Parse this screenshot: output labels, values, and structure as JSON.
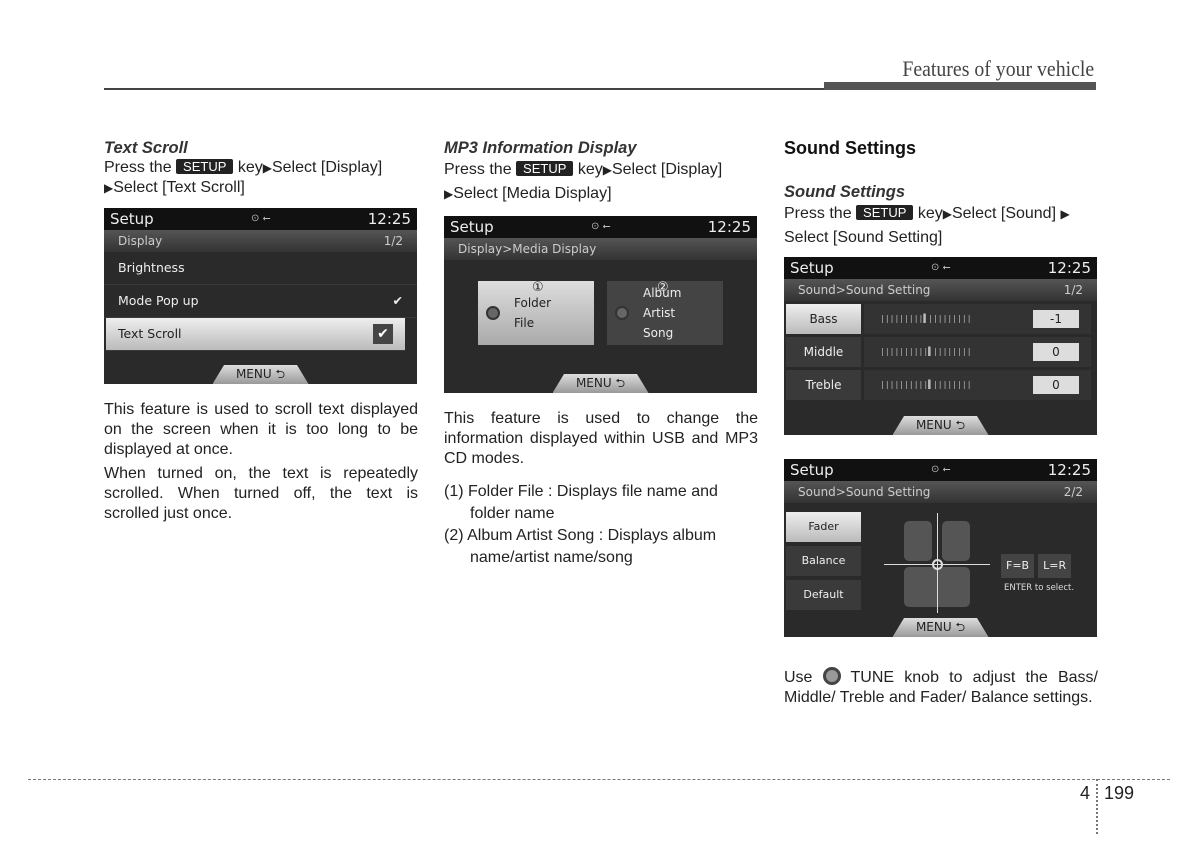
{
  "header": {
    "section_title": "Features of your vehicle"
  },
  "footer": {
    "chapter": "4",
    "page": "199"
  },
  "col1": {
    "subtitle": "Text Scroll",
    "instr_pre": "Press the ",
    "key": "SETUP",
    "instr_mid": " key",
    "arrow": "▶",
    "instr_a": "Select [Display]",
    "instr_b": "Select [Text Scroll]",
    "screen": {
      "title": "Setup",
      "icons": "⊙ ⭠",
      "time": "12:25",
      "breadcrumb": "Display",
      "page": "1/2",
      "items": [
        {
          "label": "Brightness",
          "check": ""
        },
        {
          "label": "Mode Pop up",
          "check": "✔"
        },
        {
          "label": "Text Scroll",
          "check": "✔"
        }
      ],
      "menu": "MENU ⮌"
    },
    "para1": "This feature is used to scroll text displayed on the screen when it is too long to be displayed at once.",
    "para2": "When turned on, the text is repeatedly scrolled. When turned off, the text is scrolled just once."
  },
  "col2": {
    "subtitle": "MP3 Information Display",
    "instr_pre": "Press the ",
    "key": "SETUP",
    "instr_mid": " key",
    "arrow": "▶",
    "instr_a": "Select [Display]",
    "instr_b": "Select [Media Display]",
    "screen": {
      "title": "Setup",
      "icons": "⊙ ⭠",
      "time": "12:25",
      "breadcrumb": "Display>Media Display",
      "options": [
        {
          "num": "①",
          "label": "Folder File"
        },
        {
          "num": "②",
          "label": "Album Artist Song"
        }
      ],
      "menu": "MENU ⮌"
    },
    "para1": "This feature is used to change the information displayed within USB and MP3 CD modes.",
    "list": [
      "(1) Folder File : Displays file name and folder name",
      "(2) Album Artist Song : Displays album name/artist name/song"
    ]
  },
  "col3": {
    "heading": "Sound Settings",
    "subtitle": "Sound Settings",
    "instr_pre": "Press the ",
    "key": "SETUP",
    "instr_mid": " key",
    "arrow": "▶",
    "instr_a": "Select [Sound]",
    "instr_b": "Select [Sound Setting]",
    "screen1": {
      "title": "Setup",
      "icons": "⊙ ⭠",
      "time": "12:25",
      "breadcrumb": "Sound>Sound Setting",
      "page": "1/2",
      "rows": [
        {
          "label": "Bass",
          "value": "-1",
          "level": -1
        },
        {
          "label": "Middle",
          "value": "0",
          "level": 0
        },
        {
          "label": "Treble",
          "value": "0",
          "level": 0
        }
      ],
      "menu": "MENU ⮌"
    },
    "screen2": {
      "title": "Setup",
      "icons": "⊙ ⭠",
      "time": "12:25",
      "breadcrumb": "Sound>Sound Setting",
      "page": "2/2",
      "buttons": [
        "Fader",
        "Balance",
        "Default"
      ],
      "fb": "F=B",
      "lr": "L=R",
      "hint": "ENTER to select.",
      "menu": "MENU ⮌"
    },
    "use_pre": "Use ",
    "use_post": " TUNE knob to adjust the Bass/ Middle/ Treble and Fader/ Balance settings."
  }
}
